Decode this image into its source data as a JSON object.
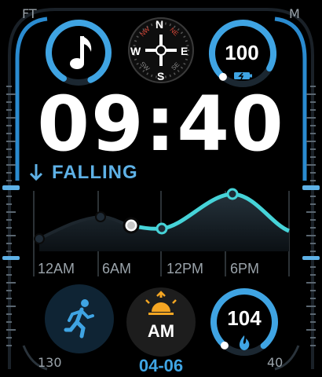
{
  "corners": {
    "top_left": "FT",
    "top_right": "M",
    "bottom_left": "130",
    "bottom_right": "40"
  },
  "music": {
    "icon": "music-note-icon",
    "ring_progress": 0.85
  },
  "compass": {
    "north": "N",
    "south": "S",
    "east": "E",
    "west": "W",
    "ne": "NE",
    "nw": "NW",
    "se": "SE",
    "sw": "SW"
  },
  "battery": {
    "value": "100",
    "ring_progress": 0.72,
    "icon": "battery-charging-icon"
  },
  "time": {
    "text": "09:40"
  },
  "trend": {
    "label": "FALLING",
    "icon": "arrow-down-icon"
  },
  "graph": {
    "hours": [
      "12AM",
      "6AM",
      "12PM",
      "6PM"
    ]
  },
  "workout": {
    "icon": "running-person-icon"
  },
  "sunrise": {
    "label": "AM",
    "icon": "sunrise-icon"
  },
  "calories": {
    "value": "104",
    "ring_progress": 0.78,
    "icon": "flame-icon"
  },
  "date": {
    "text": "04-06"
  },
  "colors": {
    "accent_blue": "#3fa4e3",
    "graph_cyan": "#46d3d8",
    "background": "#000000"
  }
}
